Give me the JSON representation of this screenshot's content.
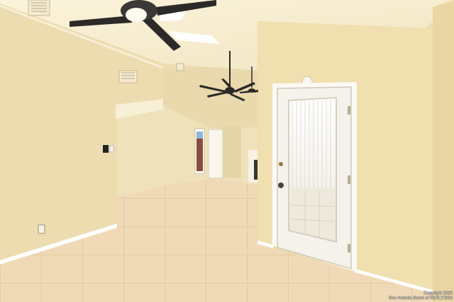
{
  "photo": {
    "subject": "Empty living room interior",
    "watermark": {
      "line1": "Copyright 2025",
      "line2": "San Antonio Board of REALTORS"
    }
  }
}
